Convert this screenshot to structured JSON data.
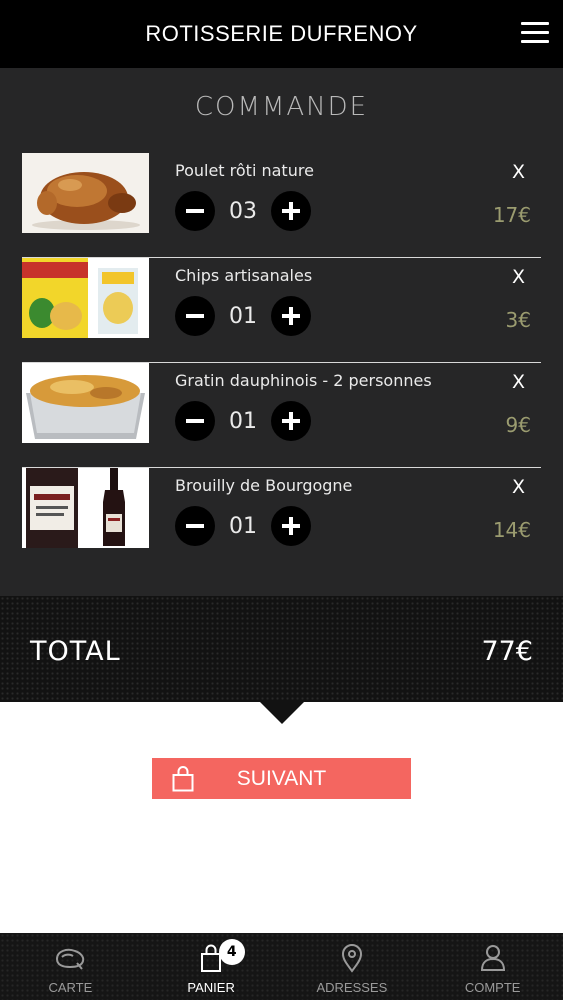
{
  "header": {
    "title": "ROTISSERIE DUFRENOY",
    "menu_icon": "hamburger-menu-icon"
  },
  "cart": {
    "heading": "COMMANDE",
    "items": [
      {
        "name": "Poulet rôti nature",
        "qty": "03",
        "remove": "X",
        "price": "17€",
        "image": "roast-chicken"
      },
      {
        "name": "Chips artisanales",
        "qty": "01",
        "remove": "X",
        "price": "3€",
        "image": "chips-bags"
      },
      {
        "name": "Gratin dauphinois - 2 personnes",
        "qty": "01",
        "remove": "X",
        "price": "9€",
        "image": "gratin-tray"
      },
      {
        "name": "Brouilly de Bourgogne",
        "qty": "01",
        "remove": "X",
        "price": "14€",
        "image": "wine-bottles"
      }
    ]
  },
  "total": {
    "label": "TOTAL",
    "value": "77€"
  },
  "next_button": {
    "label": "SUIVANT",
    "icon": "shopping-bag-icon"
  },
  "tabs": [
    {
      "label": "CARTE",
      "icon": "chicken-icon",
      "active": false
    },
    {
      "label": "PANIER",
      "icon": "shopping-bag-icon",
      "active": true,
      "badge": "4"
    },
    {
      "label": "ADRESSES",
      "icon": "location-pin-icon",
      "active": false
    },
    {
      "label": "COMPTE",
      "icon": "user-icon",
      "active": false
    }
  ],
  "colors": {
    "accent": "#f46660",
    "price": "#9b9c70",
    "panel": "#262627",
    "header": "#000000"
  }
}
